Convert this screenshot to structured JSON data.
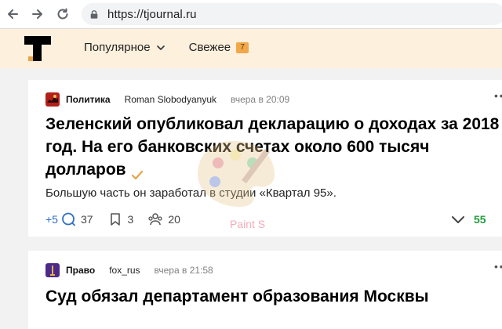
{
  "browser": {
    "url": "https://tjournal.ru",
    "icons": {
      "back": "arrow-left-icon",
      "forward": "arrow-right-icon",
      "reload": "reload-icon",
      "lock": "lock-icon"
    }
  },
  "header": {
    "logo": "tjournal-logo",
    "nav": {
      "popular_label": "Популярное",
      "fresh_label": "Свежее",
      "fresh_badge": "7"
    },
    "colors": {
      "background": "#fdf0dc",
      "badge": "#f0a84a"
    }
  },
  "feed": [
    {
      "subsite": "Политика",
      "author": "Roman Slobodyanyuk",
      "time": "вчера в 20:09",
      "more": "• •",
      "title_lines": [
        "Зеленский опубликовал декларацию о доходах за 2018",
        "год. На его банковских счетах около 600 тысяч",
        "долларов"
      ],
      "verified": true,
      "excerpt": "Большую часть он заработал в студии «Квартал 95».",
      "comments_new": "+5",
      "comments_count": "37",
      "bookmarks_count": "3",
      "reposts_count": "20",
      "rating": "55",
      "colors": {
        "rating": "#1f9d3a",
        "comments_new": "#2f6ec2"
      }
    },
    {
      "subsite": "Право",
      "author": "fox_rus",
      "time": "вчера в 21:58",
      "more": "• •",
      "title_lines": [
        "Суд обязал департамент образования Москвы"
      ]
    }
  ],
  "watermark": {
    "text": "Paint S",
    "icon": "palette-icon"
  }
}
